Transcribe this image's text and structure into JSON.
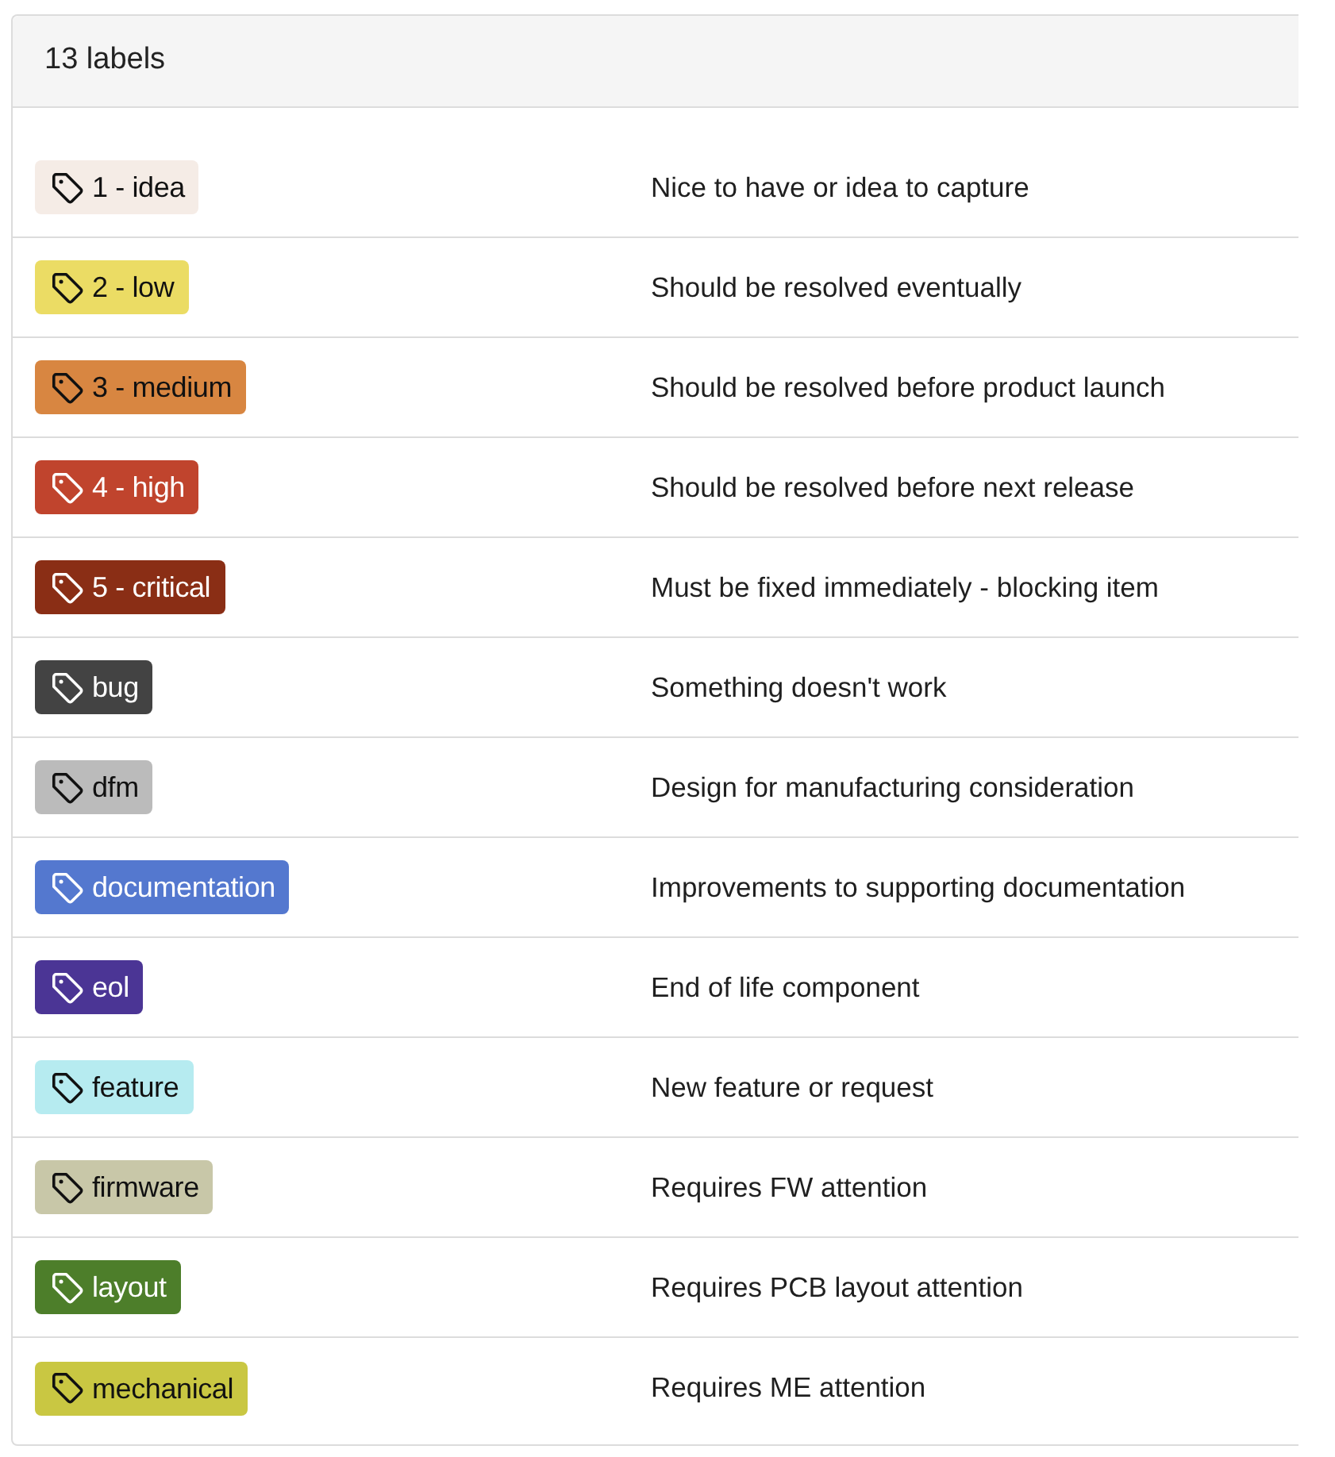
{
  "header": {
    "title": "13 labels"
  },
  "labels": [
    {
      "name": "1 - idea",
      "description": "Nice to have or idea to capture",
      "color": "#f5ece6"
    },
    {
      "name": "2 - low",
      "description": "Should be resolved eventually",
      "color": "#ebdc64"
    },
    {
      "name": "3 - medium",
      "description": "Should be resolved before product launch",
      "color": "#d88641"
    },
    {
      "name": "4 - high",
      "description": "Should be resolved before next release",
      "color": "#c0442d"
    },
    {
      "name": "5 - critical",
      "description": "Must be fixed immediately - blocking item",
      "color": "#8a2e15"
    },
    {
      "name": "bug",
      "description": "Something doesn't work",
      "color": "#434343"
    },
    {
      "name": "dfm",
      "description": "Design for manufacturing consideration",
      "color": "#bbbbbb"
    },
    {
      "name": "documentation",
      "description": "Improvements to supporting documentation",
      "color": "#5478cf"
    },
    {
      "name": "eol",
      "description": "End of life component",
      "color": "#4b3595"
    },
    {
      "name": "feature",
      "description": "New feature or request",
      "color": "#b6ebf0"
    },
    {
      "name": "firmware",
      "description": "Requires FW attention",
      "color": "#c8c7a8"
    },
    {
      "name": "layout",
      "description": "Requires PCB layout attention",
      "color": "#4d7e2a"
    },
    {
      "name": "mechanical",
      "description": "Requires ME attention",
      "color": "#c9c742"
    }
  ]
}
